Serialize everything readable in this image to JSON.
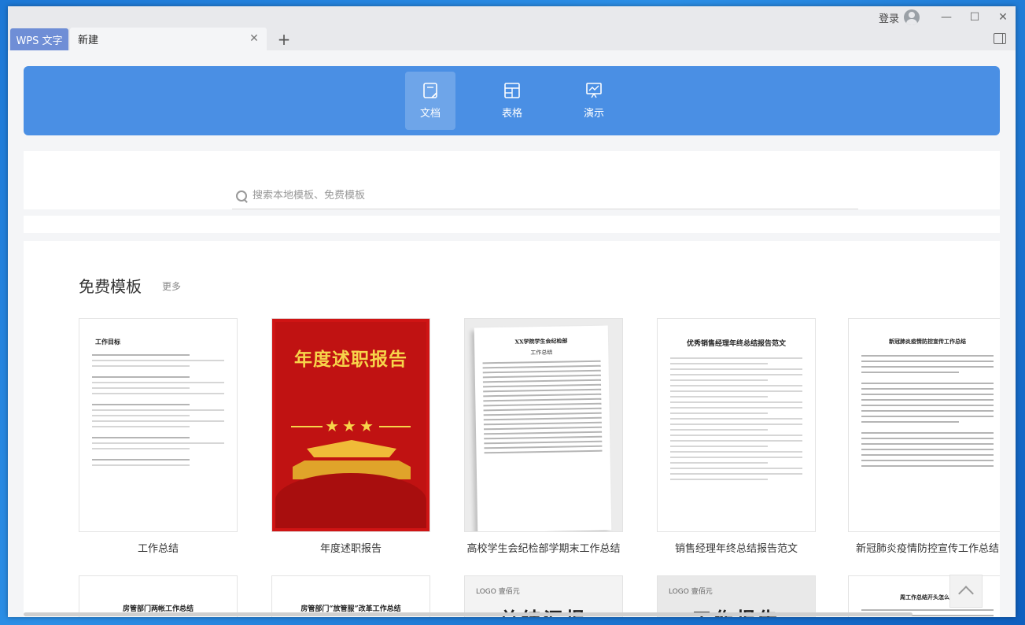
{
  "titlebar": {
    "login_label": "登录",
    "minimize": "—",
    "maximize": "☐",
    "close": "✕"
  },
  "tabs": {
    "app_tab": "WPS 文字",
    "current_tab": "新建",
    "close_glyph": "✕",
    "add_glyph": "+"
  },
  "type_bar": {
    "items": [
      {
        "label": "文档",
        "icon": "document-icon",
        "active": true
      },
      {
        "label": "表格",
        "icon": "table-icon",
        "active": false
      },
      {
        "label": "演示",
        "icon": "presentation-icon",
        "active": false
      }
    ]
  },
  "search": {
    "placeholder": "搜索本地模板、免费模板"
  },
  "templates": {
    "section_title": "免费模板",
    "more_label": "更多",
    "row1": [
      {
        "caption": "工作总结",
        "preview_title": "工作目标"
      },
      {
        "caption": "年度述职报告",
        "preview_title": "年度述职报告"
      },
      {
        "caption": "高校学生会纪检部学期末工作总结",
        "preview_title": "XX学院学生会纪检部",
        "preview_sub": "工作总结"
      },
      {
        "caption": "销售经理年终总结报告范文",
        "preview_title": "优秀销售经理年终总结报告范文"
      },
      {
        "caption": "新冠肺炎疫情防控宣传工作总结",
        "preview_title": "新冠肺炎疫情防控宣传工作总结"
      }
    ],
    "row2": [
      {
        "preview_title": "房管部门两帐工作总结"
      },
      {
        "preview_title": "房管部门“放管服”改革工作总结"
      },
      {
        "preview_logo": "LOGO 壹佰元",
        "preview_title": "总结汇报"
      },
      {
        "preview_logo": "LOGO 壹佰元",
        "preview_title": "工作报告"
      },
      {
        "preview_title": "周工作总结开头怎么写"
      }
    ]
  },
  "colors": {
    "accent": "#4a8fe4",
    "app_tab": "#6f8ed6",
    "red_cover": "#c01212",
    "gold": "#f7d44a"
  }
}
